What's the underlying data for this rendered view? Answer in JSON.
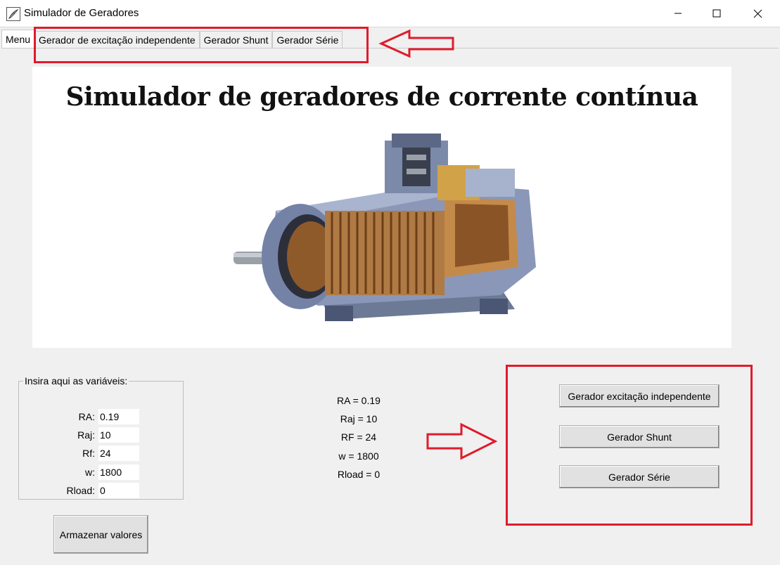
{
  "window": {
    "title": "Simulador de Geradores"
  },
  "tabs": [
    {
      "label": "Menu"
    },
    {
      "label": "Gerador de excitação independente"
    },
    {
      "label": "Gerador Shunt"
    },
    {
      "label": "Gerador Série"
    }
  ],
  "banner": {
    "title": "Simulador de geradores de corrente contínua"
  },
  "variables": {
    "legend": "Insira aqui as variáveis:",
    "fields": [
      {
        "label": "RA:",
        "value": "0.19"
      },
      {
        "label": "Raj:",
        "value": "10"
      },
      {
        "label": "Rf:",
        "value": "24"
      },
      {
        "label": "w:",
        "value": "1800"
      },
      {
        "label": "Rload:",
        "value": "0"
      }
    ],
    "store_button": "Armazenar valores"
  },
  "summary": [
    "RA = 0.19",
    "Raj = 10",
    "RF = 24",
    "w = 1800",
    "Rload = 0"
  ],
  "generator_buttons": [
    {
      "label": "Gerador excitação independente"
    },
    {
      "label": "Gerador Shunt"
    },
    {
      "label": "Gerador Série"
    }
  ],
  "annotation_color": "#e01b2c"
}
